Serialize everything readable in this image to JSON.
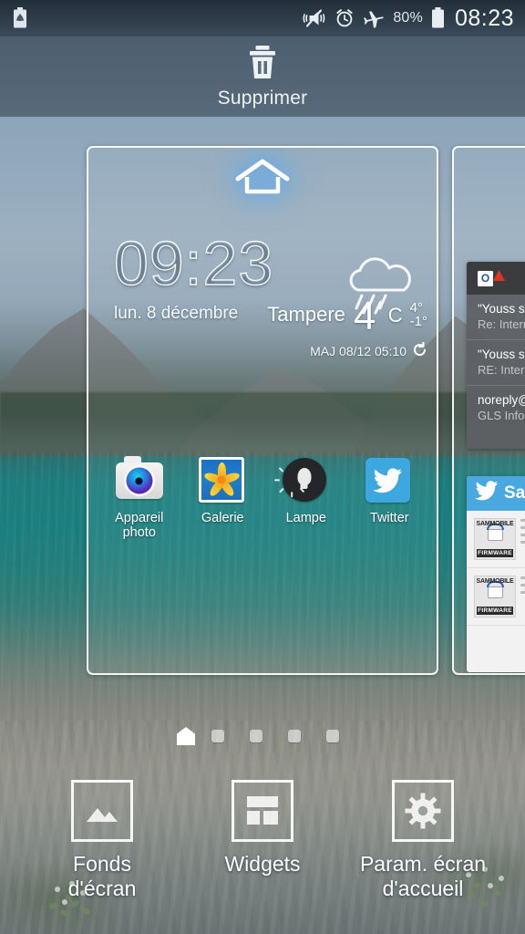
{
  "status_bar": {
    "icons": [
      "battery-saver-icon",
      "vibrate-mute-icon",
      "alarm-icon",
      "airplane-mode-icon"
    ],
    "battery_percent": "80%",
    "time": "08:23"
  },
  "delete_zone": {
    "label": "Supprimer",
    "icon": "trash-icon"
  },
  "current_page": {
    "home_badge_icon": "home-icon",
    "clock_widget": {
      "time": "09:23",
      "date": "lun. 8 décembre",
      "weather": {
        "icon": "rain-cloud-icon",
        "city": "Tampere",
        "temperature": "4",
        "degree": "°",
        "unit": "C",
        "high": "4",
        "high_degree": "°",
        "low": "-1",
        "low_degree": "°",
        "updated": "MAJ 08/12 05:10",
        "refresh_icon": "refresh-icon"
      }
    },
    "apps": [
      {
        "name": "Appareil photo",
        "icon": "camera-icon"
      },
      {
        "name": "Galerie",
        "icon": "gallery-flower-icon"
      },
      {
        "name": "Lampe",
        "icon": "flashlight-icon"
      },
      {
        "name": "Twitter",
        "icon": "twitter-bird-icon"
      }
    ]
  },
  "next_page": {
    "email_widget": {
      "app_icon": "outlook-icon",
      "alert_icon": "warning-icon",
      "messages": [
        {
          "from": "\"Youss se",
          "subject": "Re: Intern"
        },
        {
          "from": "\"Youss se",
          "subject": "RE: Intern"
        },
        {
          "from": "noreply@",
          "subject": "GLS Infor"
        }
      ]
    },
    "twitter_widget": {
      "icon": "twitter-bird-icon",
      "title": "Sa",
      "tweets": [
        {
          "thumb_top": "SAMMOBILE",
          "thumb_tag": "FIRMWARE"
        },
        {
          "thumb_top": "SAMMOBILE",
          "thumb_tag": "FIRMWARE"
        }
      ]
    }
  },
  "page_indicator": {
    "pages": [
      "home",
      "page-2",
      "page-3",
      "page-4",
      "page-5"
    ],
    "active_index": 0
  },
  "bottom_actions": [
    {
      "label": "Fonds\nd'écran",
      "label_line1": "Fonds",
      "label_line2": "d'écran",
      "icon": "wallpaper-image-icon"
    },
    {
      "label": "Widgets",
      "label_line1": "Widgets",
      "label_line2": "",
      "icon": "widgets-grid-icon"
    },
    {
      "label": "Param. écran d'accueil",
      "label_line1": "Param. écran",
      "label_line2": "d'accueil",
      "icon": "gear-icon"
    }
  ],
  "colors": {
    "accent_blue": "#3da8e0",
    "status_bar": "#2c3a48",
    "delete_bar": "#4e6272",
    "water": "#1b918d"
  }
}
